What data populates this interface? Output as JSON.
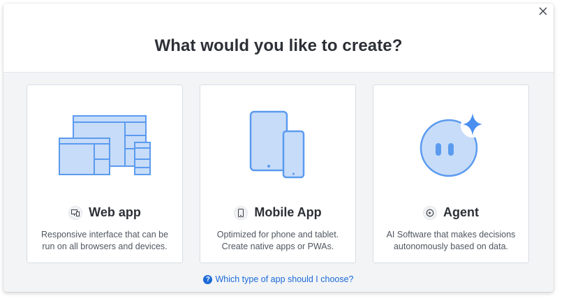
{
  "dialog": {
    "title": "What would you like to create?",
    "close_icon": "close-icon"
  },
  "cards": [
    {
      "label": "Web app",
      "icon": "monitor-phone-icon",
      "description": "Responsive interface that can be run on all browsers and devices."
    },
    {
      "label": "Mobile App",
      "icon": "smartphone-icon",
      "description": "Optimized for phone and tablet. Create native apps or PWAs."
    },
    {
      "label": "Agent",
      "icon": "agent-icon",
      "description": "AI Software that makes decisions autonomously based on data."
    }
  ],
  "help_link": {
    "icon": "question-circle-icon",
    "text": "Which type of app should I choose?"
  },
  "colors": {
    "accent": "#1b6ad8",
    "illustration_fill": "#c7dcf9",
    "illustration_stroke": "#5b9bef"
  }
}
